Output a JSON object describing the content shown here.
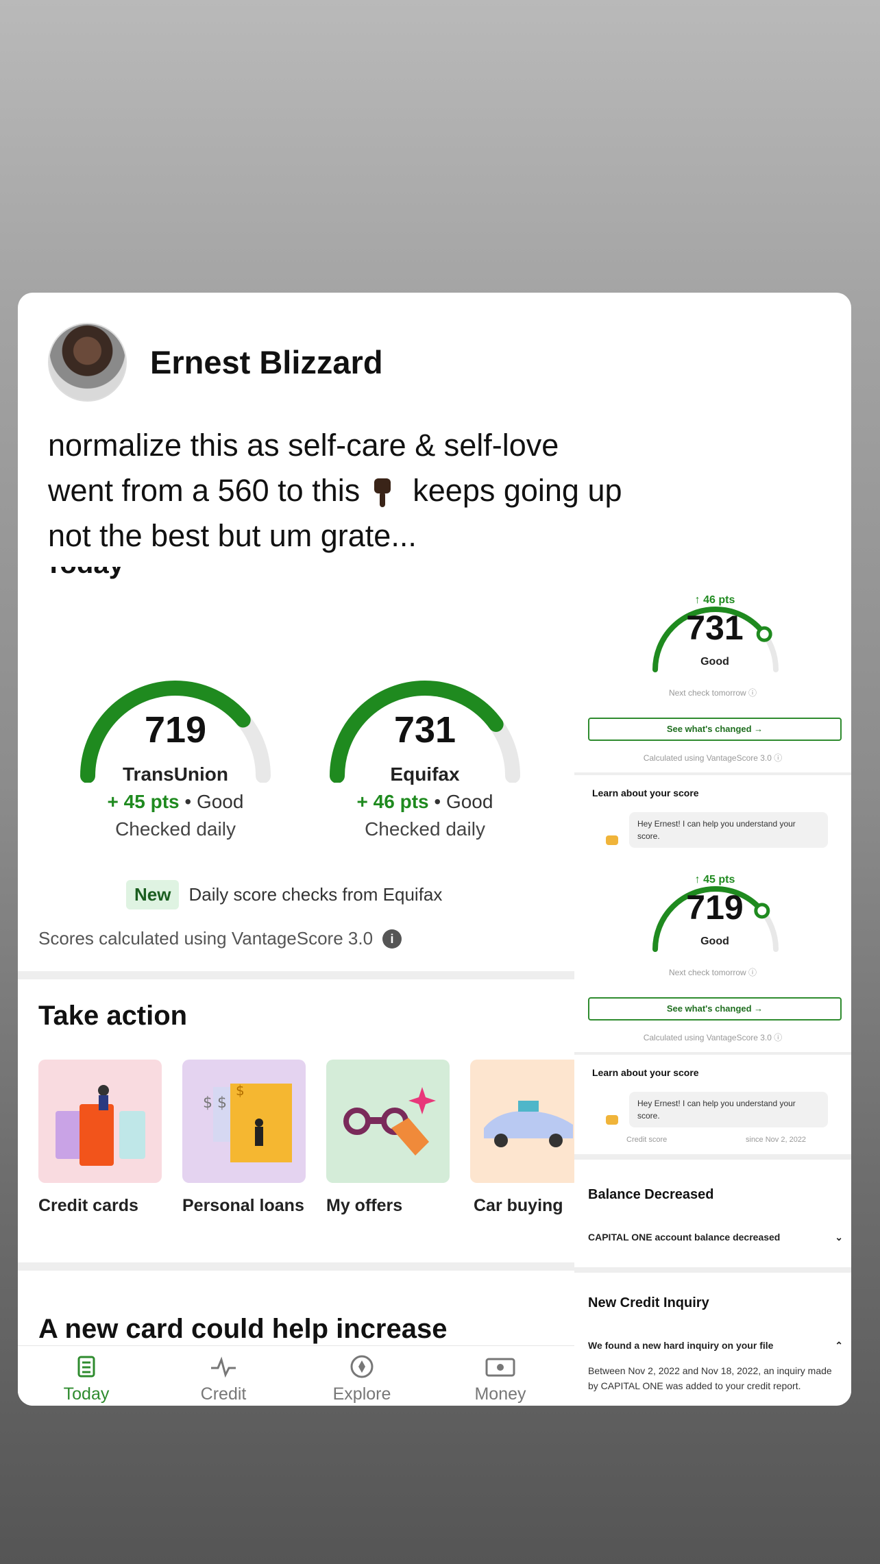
{
  "post": {
    "author": "Ernest Blizzard",
    "caption_lines": [
      "normalize this as self-care & self-love",
      "went from a 560 to this",
      "keeps going up",
      "not the best but um grate..."
    ]
  },
  "app_left": {
    "section_cut": "Today",
    "scores": [
      {
        "score": "719",
        "bureau": "TransUnion",
        "pts": "+ 45 pts",
        "rating": "• Good",
        "checked": "Checked daily",
        "fill_fraction": 0.78
      },
      {
        "score": "731",
        "bureau": "Equifax",
        "pts": "+ 46 pts",
        "rating": "• Good",
        "checked": "Checked daily",
        "fill_fraction": 0.8
      }
    ],
    "new_badge": "New",
    "new_text": "Daily score checks from Equifax",
    "scores_calc": "Scores calculated using VantageScore 3.0",
    "info_icon": "i",
    "take_action": "Take action",
    "tiles": [
      {
        "label": "Credit cards",
        "icon": "credit-card-illustration",
        "color": "#f9dbe0"
      },
      {
        "label": "Personal loans",
        "icon": "loan-illustration",
        "color": "#e4d3f0"
      },
      {
        "label": "My offers",
        "icon": "binoculars-illustration",
        "color": "#d4ecd8"
      },
      {
        "label": "Car buying",
        "icon": "car-illustration",
        "color": "#fde5cf"
      }
    ],
    "new_card_heading": "A new card could help increase",
    "nav": [
      "Today",
      "Credit",
      "Explore",
      "Money"
    ]
  },
  "app_right": {
    "gauges": [
      {
        "pts": "↑ 46 pts",
        "score": "731",
        "rating": "Good",
        "next_check": "Next check tomorrow ⓘ",
        "see_changed": "See what's changed →",
        "calc": "Calculated using VantageScore 3.0 ⓘ",
        "learn": "Learn about your score",
        "bubble": "Hey Ernest! I can help you understand your score."
      },
      {
        "pts": "↑ 45 pts",
        "score": "719",
        "rating": "Good",
        "next_check": "Next check tomorrow ⓘ",
        "see_changed": "See what's changed →",
        "calc": "Calculated using VantageScore 3.0 ⓘ",
        "learn": "Learn about your score",
        "bubble": "Hey Ernest! I can help you understand your score."
      }
    ],
    "credit_score_small": "Credit score",
    "since_small": "since Nov 2, 2022",
    "balance_title": "Balance Decreased",
    "balance_line": "CAPITAL ONE account balance decreased",
    "inquiry_title": "New Credit Inquiry",
    "inquiry_line": "We found a new hard inquiry on your file",
    "inquiry_body": "Between Nov 2, 2022 and Nov 18, 2022, an inquiry made by CAPITAL ONE was added to your credit report."
  },
  "colors": {
    "accent_green": "#1f8a1f",
    "gauge_track": "#e8e8e8"
  }
}
